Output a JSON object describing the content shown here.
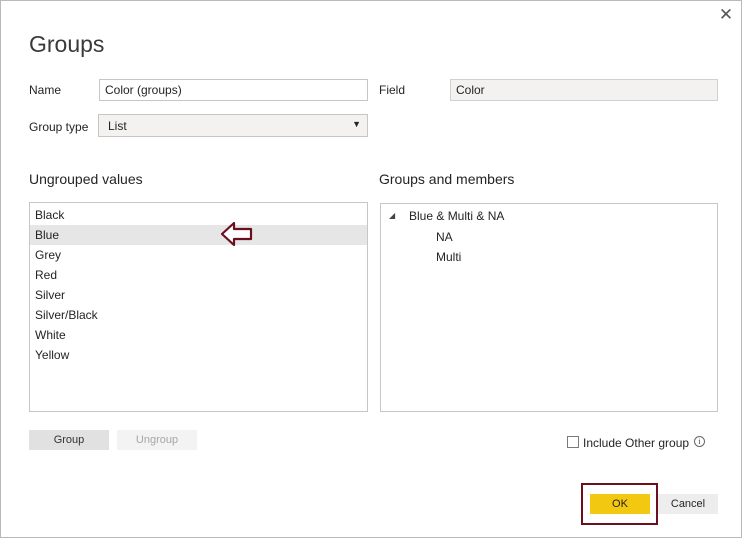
{
  "dialog": {
    "title": "Groups",
    "close_icon": "close-icon"
  },
  "form": {
    "name_label": "Name",
    "name_value": "Color (groups)",
    "field_label": "Field",
    "field_value": "Color",
    "group_type_label": "Group type",
    "group_type_value": "List",
    "group_type_caret": "▼"
  },
  "ungrouped": {
    "title": "Ungrouped values",
    "items": [
      "Black",
      "Blue",
      "Grey",
      "Red",
      "Silver",
      "Silver/Black",
      "White",
      "Yellow"
    ],
    "selected_item": "Blue"
  },
  "groups": {
    "title": "Groups and members",
    "group_name": "Blue & Multi & NA",
    "expand_glyph": "◢",
    "members": [
      "NA",
      "Multi"
    ]
  },
  "buttons": {
    "group_label": "Group",
    "ungroup_label": "Ungroup",
    "ok_label": "OK",
    "cancel_label": "Cancel"
  },
  "include_other": {
    "label": "Include Other group",
    "checked": false,
    "info_glyph": "i"
  },
  "colors": {
    "ok_button": "#f2c811",
    "annotation": "#6b0f1f"
  }
}
